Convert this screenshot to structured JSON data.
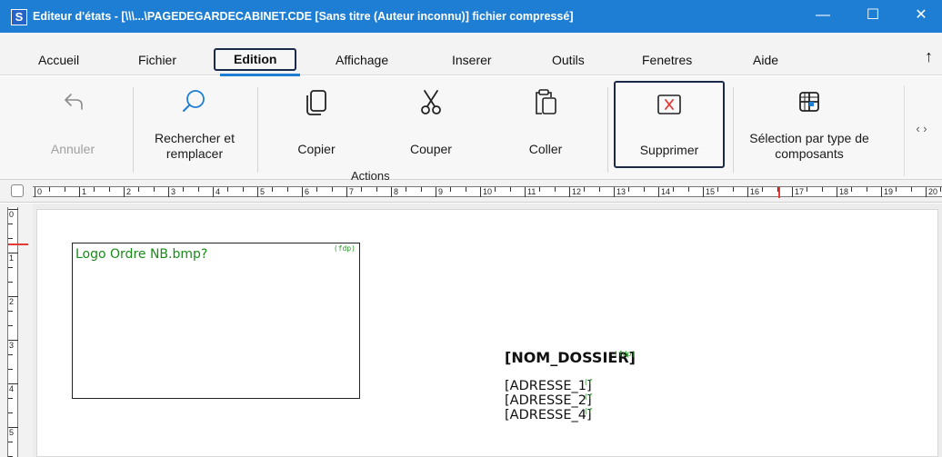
{
  "window": {
    "app_icon_letter": "S",
    "title": "Editeur d'états - [\\\\\\...\\PAGEDEGARDECABINET.CDE [Sans titre (Auteur inconnu)] fichier compressé]",
    "minimize_glyph": "—",
    "maximize_glyph": "☐",
    "close_glyph": "✕"
  },
  "menu": {
    "items": [
      "Accueil",
      "Fichier",
      "Edition",
      "Affichage",
      "Inserer",
      "Outils",
      "Fenetres",
      "Aide"
    ],
    "active": "Edition",
    "collapse_glyph": "↑"
  },
  "ribbon": {
    "buttons": {
      "annuler": "Annuler",
      "rechercher": "Rechercher et remplacer",
      "copier": "Copier",
      "couper": "Couper",
      "coller": "Coller",
      "supprimer": "Supprimer",
      "selection": "Sélection par type de composants"
    },
    "group_label": "Actions",
    "scroll_glyphs": "‹ ›",
    "disabled": [
      "Annuler"
    ]
  },
  "ruler": {
    "marks": [
      "0",
      "1",
      "2",
      "3",
      "4",
      "5",
      "6",
      "7",
      "8",
      "9",
      "10",
      "11",
      "12",
      "13",
      "14",
      "15",
      "16",
      "17",
      "18",
      "19",
      "20"
    ],
    "vertical_marks": [
      "0",
      "1",
      "2",
      "3",
      "4",
      "5"
    ]
  },
  "canvas": {
    "logo_text": "Logo Ordre NB.bmp?",
    "logo_tag": "(fdp)",
    "nom_dossier": "[NOM_DOSSIER]",
    "adresse_1": "[ADRESSE_1]",
    "adresse_2": "[ADRESSE_2]",
    "adresse_4": "[ADRESSE_4]",
    "field_tag": "(fdp)",
    "small_tag": "(f"
  },
  "colors": {
    "titlebar": "#1d7ed3",
    "field_green": "#1a8a1a",
    "ruler_marker": "#e53935",
    "focus_border": "#1b2a4a"
  }
}
